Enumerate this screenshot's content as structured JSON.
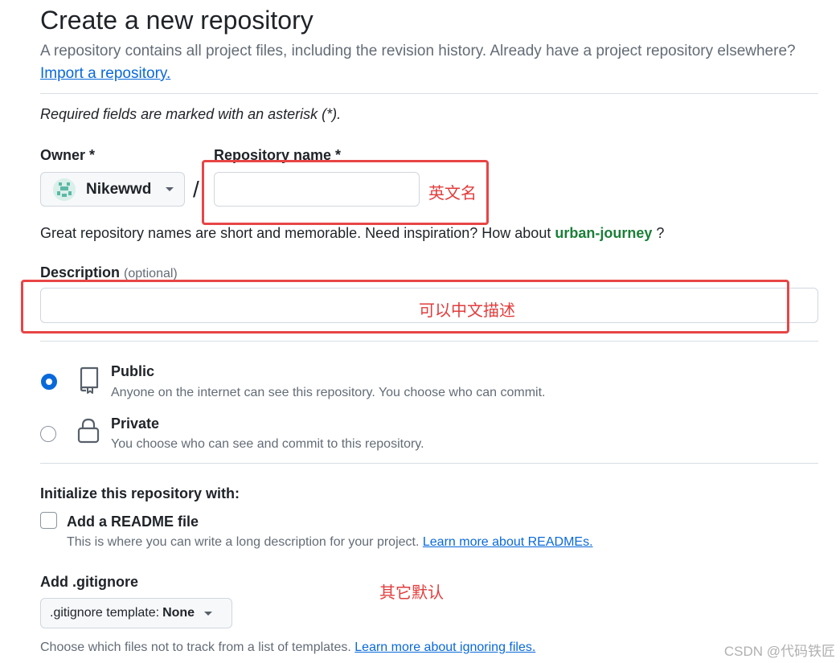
{
  "page": {
    "title": "Create a new repository",
    "subtitle": "A repository contains all project files, including the revision history. Already have a project repository elsewhere?",
    "import_link": "Import a repository.",
    "required_note": "Required fields are marked with an asterisk (*)."
  },
  "owner": {
    "label": "Owner *",
    "value": "Nikewwd",
    "icon": "identicon-avatar"
  },
  "separator": "/",
  "repo_name": {
    "label": "Repository name *",
    "value": "",
    "placeholder": ""
  },
  "name_hint": {
    "text": "Great repository names are short and memorable. Need inspiration? How about",
    "suggestion": "urban-journey",
    "suffix": "?"
  },
  "description": {
    "label": "Description",
    "optional": "(optional)",
    "value": "",
    "placeholder": ""
  },
  "visibility": {
    "public": {
      "title": "Public",
      "desc": "Anyone on the internet can see this repository. You choose who can commit.",
      "checked": true,
      "icon": "repo-book-icon"
    },
    "private": {
      "title": "Private",
      "desc": "You choose who can see and commit to this repository.",
      "checked": false,
      "icon": "lock-icon"
    }
  },
  "init": {
    "heading": "Initialize this repository with:",
    "readme": {
      "label": "Add a README file",
      "desc": "This is where you can write a long description for your project.",
      "link": "Learn more about READMEs.",
      "checked": false
    }
  },
  "gitignore": {
    "label": "Add .gitignore",
    "select_prefix": ".gitignore template:",
    "select_value": "None",
    "desc": "Choose which files not to track from a list of templates.",
    "link": "Learn more about ignoring files."
  },
  "annotations": {
    "repo_name_note": "英文名",
    "description_note": "可以中文描述",
    "defaults_note": "其它默认",
    "color": "#e84545"
  },
  "colors": {
    "accent": "#0969da",
    "suggestion": "#1a7f37",
    "annotation": "#e84545"
  },
  "watermark": "CSDN @代码铁匠"
}
